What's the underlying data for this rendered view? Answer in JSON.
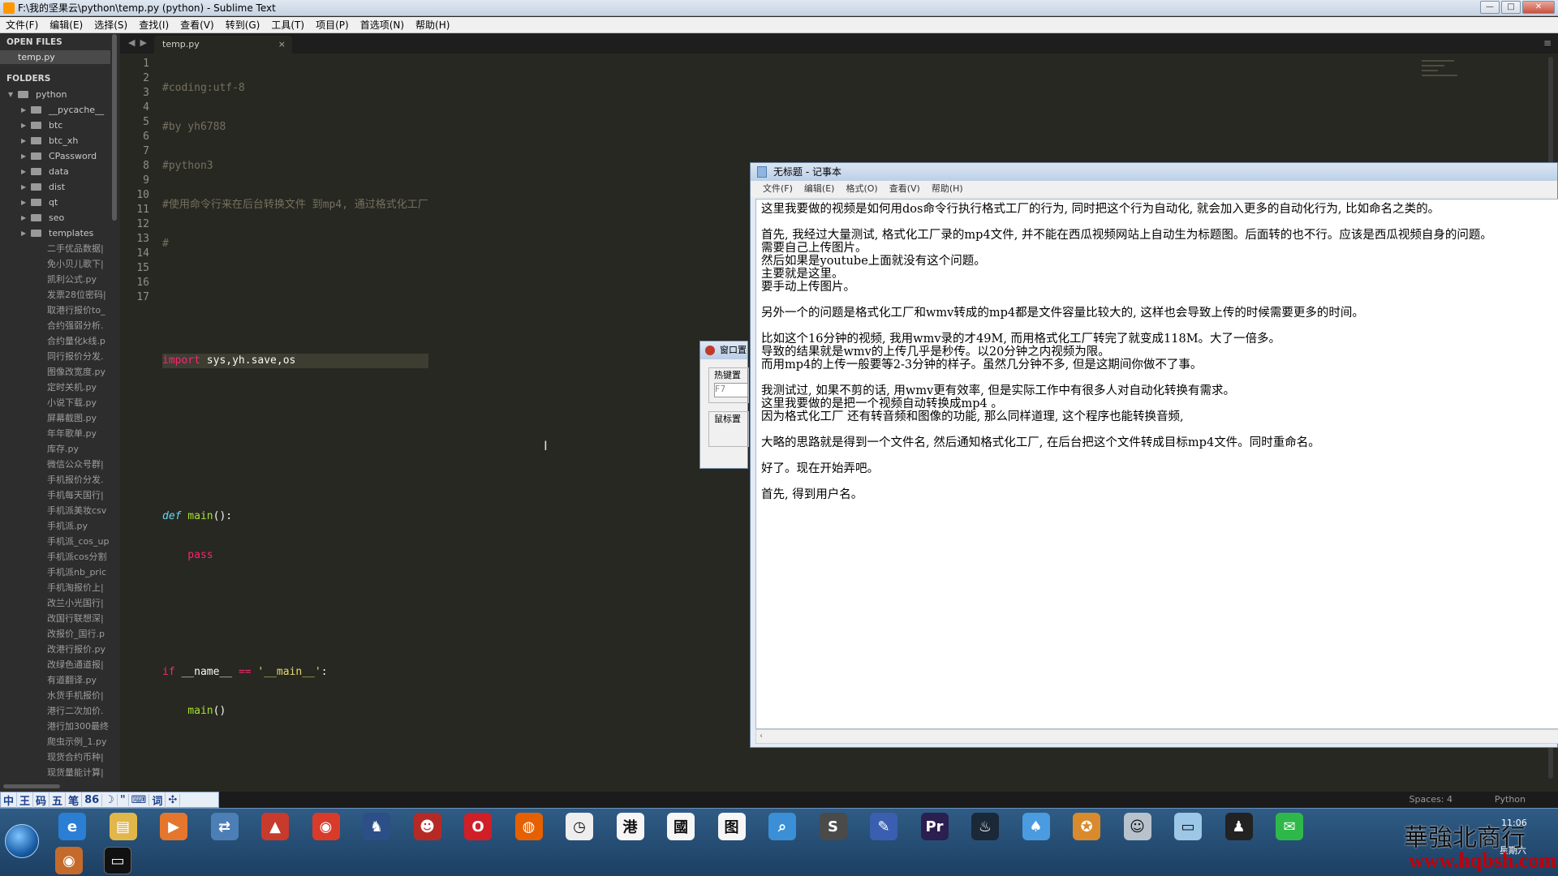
{
  "window": {
    "title": "F:\\我的坚果云\\python\\temp.py (python) - Sublime Text"
  },
  "menubar": [
    "文件(F)",
    "编辑(E)",
    "选择(S)",
    "查找(I)",
    "查看(V)",
    "转到(G)",
    "工具(T)",
    "项目(P)",
    "首选项(N)",
    "帮助(H)"
  ],
  "sidebar": {
    "open_files_header": "OPEN FILES",
    "open_file": "temp.py",
    "folders_header": "FOLDERS",
    "root": "python",
    "folders": [
      "__pycache__",
      "btc",
      "btc_xh",
      "CPassword",
      "data",
      "dist",
      "qt",
      "seo",
      "templates"
    ],
    "files": [
      "二手优品数据|",
      "免小贝儿歌下|",
      "凯利公式.py",
      "发票28位密码|",
      "取港行报价to_",
      "合约强弱分析.",
      "合约量化k线.p",
      "同行报价分发.",
      "图像改宽度.py",
      "定时关机.py",
      "小说下载.py",
      "屏幕截图.py",
      "年年歌单.py",
      "库存.py",
      "微信公众号群|",
      "手机报价分发.",
      "手机每天国行|",
      "手机派美妆csv",
      "手机派.py",
      "手机派_cos_up",
      "手机派cos分割",
      "手机派nb_pric",
      "手机淘报价上|",
      "改兰小光国行|",
      "改国行联想深|",
      "改报价_国行.p",
      "改港行报价.py",
      "改绿色通道报|",
      "有道翻译.py",
      "水货手机报价|",
      "港行二次加价.",
      "港行加300最终",
      "爬虫示例_1.py",
      "现货合约币种|",
      "现货量能计算|"
    ]
  },
  "tab": {
    "label": "temp.py",
    "close": "×"
  },
  "code_lines": [
    "#coding:utf-8",
    "#by yh6788",
    "#python3",
    "#使用命令行来在后台转换文件 到mp4, 通过格式化工厂",
    "#",
    "",
    "",
    "import sys,yh.save,os",
    "",
    "",
    "",
    "def main():",
    "    pass",
    "",
    "",
    "if __name__ == '__main__':",
    "    main()"
  ],
  "code_parts": {
    "l8_kw": "import",
    "l8_rest": " sys,yh.save,os",
    "l12_def": "def",
    "l12_fn": " main",
    "l12_rest": "():",
    "l13_kw": "    pass",
    "l16_kw": "if",
    "l16_a": " __name__ ",
    "l16_op": "==",
    "l16_st": " '__main__'",
    "l16_b": ":",
    "l17_fn": "    main",
    "l17_rest": "()"
  },
  "statusbar": {
    "spaces": "Spaces: 4",
    "syntax": "Python"
  },
  "ime": [
    "中",
    "王",
    "码",
    "五",
    "笔",
    "86",
    "☽",
    "\"",
    "⌨",
    "词",
    "✣"
  ],
  "dialog": {
    "title": "窗口置",
    "group1": "热键置",
    "field1": "F7",
    "group2": "鼠标置"
  },
  "notepad": {
    "title": "无标题 - 记事本",
    "menu": [
      "文件(F)",
      "编辑(E)",
      "格式(O)",
      "查看(V)",
      "帮助(H)"
    ],
    "lines": [
      "这里我要做的视频是如何用dos命令行执行格式工厂的行为, 同时把这个行为自动化, 就会加入更多的自动化行为, 比如命名之类的。",
      "",
      "首先, 我经过大量测试, 格式化工厂录的mp4文件, 并不能在西瓜视频网站上自动生为标题图。后面转的也不行。应该是西瓜视频自身的问题。",
      "需要自己上传图片。",
      "然后如果是youtube上面就没有这个问题。",
      "主要就是这里。",
      "要手动上传图片。",
      "",
      "另外一个的问题是格式化工厂和wmv转成的mp4都是文件容量比较大的, 这样也会导致上传的时候需要更多的时间。",
      "",
      "比如这个16分钟的视频, 我用wmv录的才49M, 而用格式化工厂转完了就变成118M。大了一倍多。",
      "导致的结果就是wmv的上传几乎是秒传。以20分钟之内视频为限。",
      "而用mp4的上传一般要等2-3分钟的样子。虽然几分钟不多, 但是这期间你做不了事。",
      "",
      "我测试过, 如果不剪的话, 用wmv更有效率, 但是实际工作中有很多人对自动化转换有需求。",
      "这里我要做的是把一个视频自动转换成mp4 。",
      "因为格式化工厂 还有转音频和图像的功能, 那么同样道理, 这个程序也能转换音频,",
      "",
      "大略的思路就是得到一个文件名, 然后通知格式化工厂, 在后台把这个文件转成目标mp4文件。同时重命名。",
      "",
      "好了。现在开始弄吧。",
      "",
      "首先, 得到用户名。"
    ]
  },
  "tray": {
    "time": "11:06",
    "weekday": "星期六"
  },
  "watermark": {
    "text": "華強北商行",
    "url": "www.hqbsh.com"
  },
  "taskbar_icons": [
    {
      "name": "ie-icon",
      "color": "#2a7fd4",
      "glyph": "e"
    },
    {
      "name": "explorer-icon",
      "color": "#e2b74a",
      "glyph": "▤"
    },
    {
      "name": "media-player-icon",
      "color": "#e5762d",
      "glyph": "▶"
    },
    {
      "name": "network-icon",
      "color": "#4b7fb5",
      "glyph": "⇄"
    },
    {
      "name": "app-red-green-icon",
      "color": "#c83a2c",
      "glyph": "▲"
    },
    {
      "name": "chrome-icon",
      "color": "#d93b2b",
      "glyph": "◉"
    },
    {
      "name": "cat-icon",
      "color": "#2c4f87",
      "glyph": "♞"
    },
    {
      "name": "angry-bird-icon",
      "color": "#b62a25",
      "glyph": "☻"
    },
    {
      "name": "opera-icon",
      "color": "#d11f27",
      "glyph": "O"
    },
    {
      "name": "firefox-icon",
      "color": "#e66000",
      "glyph": "◍"
    },
    {
      "name": "clock-icon",
      "color": "#eeeeee",
      "glyph": "◷"
    },
    {
      "name": "hk-icon",
      "color": "#f6f6f6",
      "glyph": "港"
    },
    {
      "name": "country-icon",
      "color": "#f6f6f6",
      "glyph": "國"
    },
    {
      "name": "image-icon",
      "color": "#f6f6f6",
      "glyph": "图"
    },
    {
      "name": "search-tool-icon",
      "color": "#3a8fd6",
      "glyph": "⌕"
    },
    {
      "name": "sublime-text-icon",
      "color": "#4a4a4a",
      "glyph": "S"
    },
    {
      "name": "paint-icon",
      "color": "#3a5fb0",
      "glyph": "✎"
    },
    {
      "name": "premiere-icon",
      "color": "#2a1f4f",
      "glyph": "Pr"
    },
    {
      "name": "steam-icon",
      "color": "#1b2838",
      "glyph": "♨"
    },
    {
      "name": "qq-games-icon",
      "color": "#4b9be0",
      "glyph": "♠"
    },
    {
      "name": "game-badge-icon",
      "color": "#d88a2c",
      "glyph": "✪"
    },
    {
      "name": "robot-icon",
      "color": "#b8c2cc",
      "glyph": "☺"
    },
    {
      "name": "notepad-icon",
      "color": "#9cc7e6",
      "glyph": "▭"
    },
    {
      "name": "qq-icon",
      "color": "#222222",
      "glyph": "♟"
    },
    {
      "name": "wechat-icon",
      "color": "#2fb84a",
      "glyph": "✉"
    }
  ]
}
